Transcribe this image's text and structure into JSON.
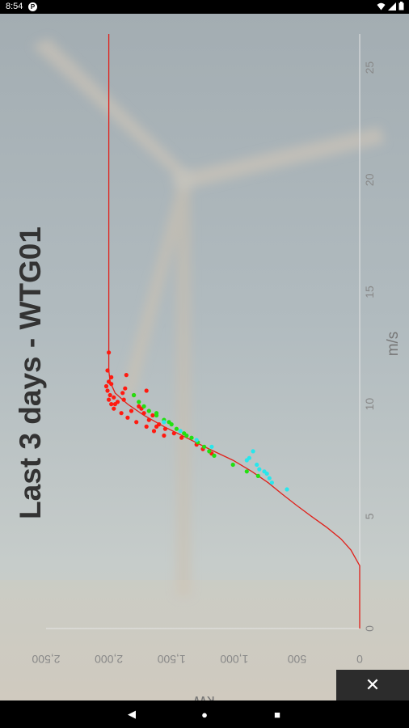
{
  "status": {
    "time": "8:54"
  },
  "chart_data": {
    "type": "scatter",
    "title": "Last 3 days - WTG01",
    "xlabel": "m/s",
    "ylabel": "kW",
    "xlim": [
      0,
      26.5
    ],
    "ylim": [
      0,
      2500
    ],
    "xticks": [
      0,
      5,
      10,
      15,
      20,
      25
    ],
    "yticks": [
      0,
      500,
      1000,
      1500,
      2000,
      2500
    ],
    "ytick_labels": [
      "0",
      "500",
      "1,000",
      "1,500",
      "2,000",
      "2,500"
    ],
    "power_curve": {
      "color": "#e0201a",
      "x": [
        0,
        2.8,
        3,
        3.5,
        4,
        4.5,
        5,
        5.5,
        6,
        6.5,
        7,
        7.5,
        8,
        8.5,
        9,
        9.5,
        10,
        10.5,
        11,
        11.5,
        12,
        12.5,
        26.5
      ],
      "y": [
        0,
        0,
        20,
        70,
        150,
        260,
        385,
        505,
        620,
        730,
        860,
        1010,
        1200,
        1380,
        1560,
        1720,
        1850,
        1950,
        1990,
        2000,
        2000,
        2000,
        2000
      ]
    },
    "series": [
      {
        "color": "#ff1a10",
        "x": [
          9.8,
          10,
          10.2,
          10.4,
          10.6,
          10.8,
          11,
          11.2,
          9.6,
          9.4,
          9.2,
          9,
          8.8,
          8.6,
          10.1,
          10.3,
          10.5,
          10.7,
          10.9,
          11.5,
          12.3,
          9.7,
          9.9,
          10.6,
          9.5,
          9.1,
          8.9,
          8.5,
          8.2,
          8.0,
          7.8,
          11.3,
          10.4,
          9.8,
          9.3,
          10.0,
          10.2,
          9.6,
          9.0,
          8.7
        ],
        "y": [
          1960,
          1980,
          2000,
          1990,
          2010,
          2020,
          2000,
          1980,
          1900,
          1850,
          1780,
          1700,
          1640,
          1560,
          1930,
          1960,
          1890,
          1870,
          1980,
          2010,
          2000,
          1820,
          1760,
          1700,
          1650,
          1600,
          1550,
          1420,
          1300,
          1250,
          1180,
          1860,
          1800,
          1740,
          1680,
          1950,
          1880,
          1720,
          1620,
          1480
        ]
      },
      {
        "color": "#22e010",
        "x": [
          10.1,
          9.9,
          9.7,
          9.5,
          9.3,
          9.1,
          8.9,
          8.7,
          8.5,
          8.3,
          8.1,
          7.9,
          7.7,
          7.3,
          7.0,
          6.8,
          10.4,
          9.6,
          9.2,
          8.6
        ],
        "y": [
          1760,
          1720,
          1680,
          1620,
          1560,
          1500,
          1460,
          1400,
          1340,
          1290,
          1240,
          1200,
          1160,
          1010,
          900,
          810,
          1800,
          1620,
          1520,
          1380
        ]
      },
      {
        "color": "#28e6ec",
        "x": [
          7.9,
          7.5,
          7.3,
          7.1,
          7.0,
          6.9,
          6.7,
          6.5,
          8.1,
          8.4,
          8.8,
          9.2,
          7.6,
          6.2
        ],
        "y": [
          850,
          900,
          820,
          800,
          760,
          740,
          720,
          700,
          1180,
          1300,
          1430,
          1560,
          880,
          580
        ]
      }
    ]
  }
}
